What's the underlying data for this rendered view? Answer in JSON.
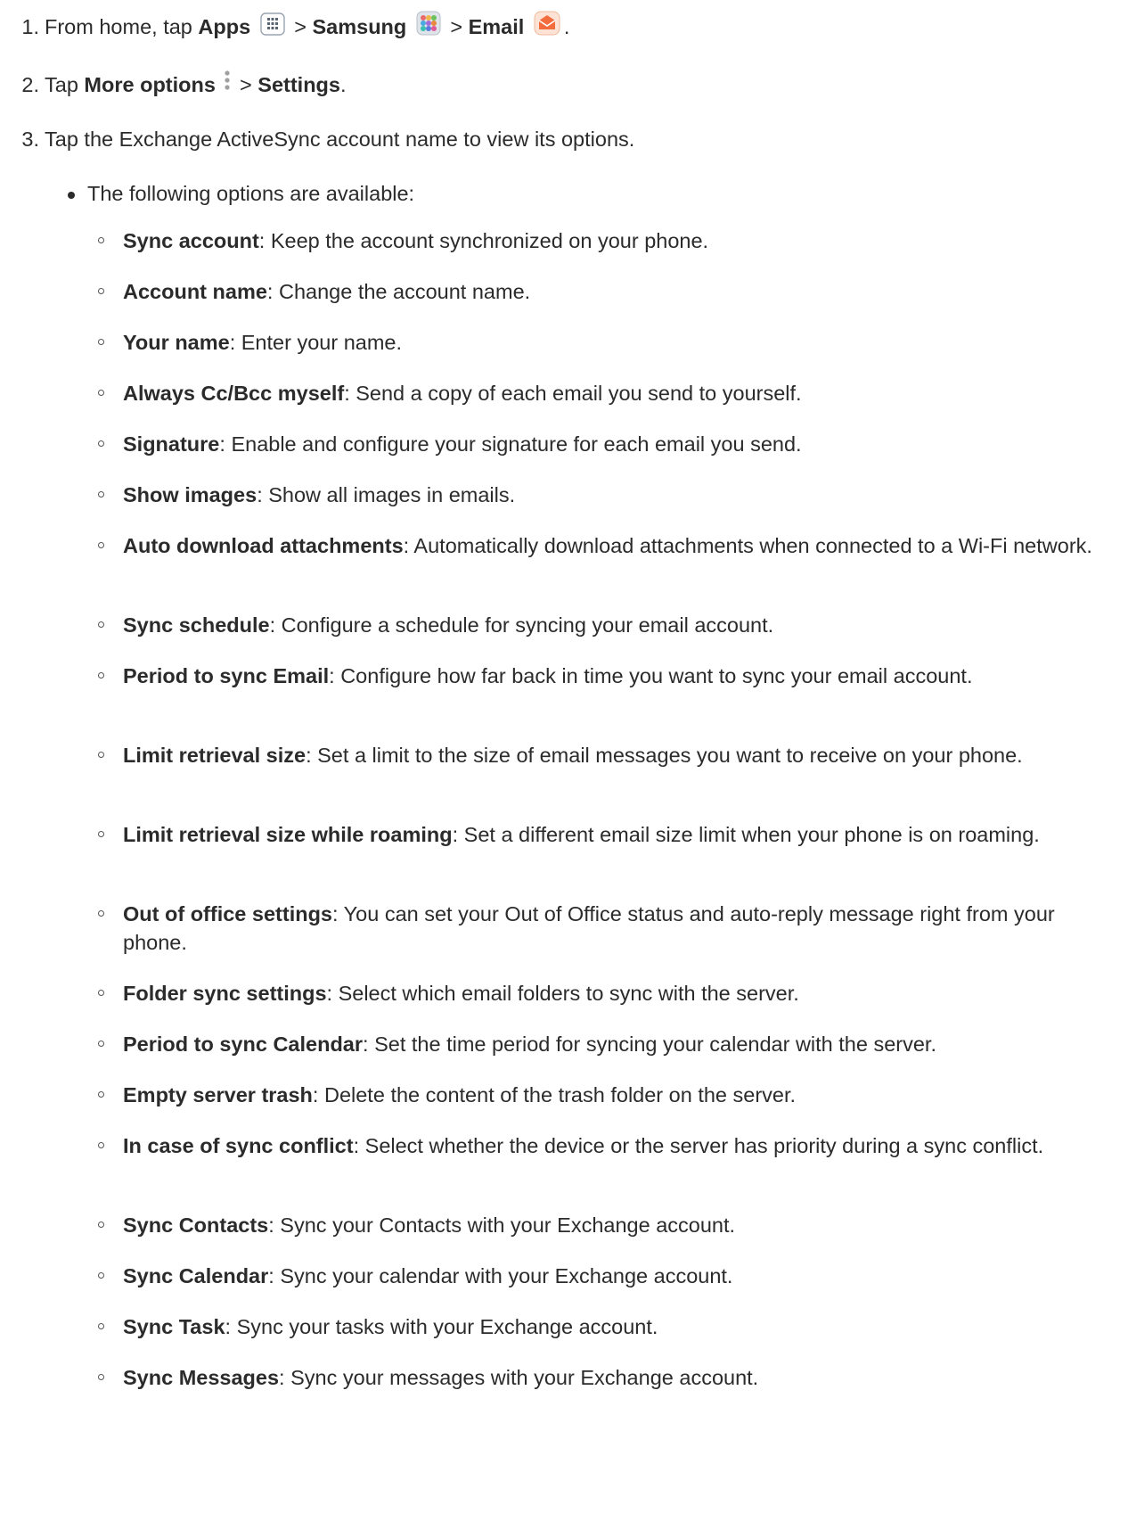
{
  "steps": [
    {
      "num": "1.",
      "prefix": "From home, tap ",
      "apps": "Apps",
      "sep1": " > ",
      "samsung": "Samsung",
      "sep2": " > ",
      "email": "Email",
      "end": "."
    },
    {
      "num": "2.",
      "prefix": "Tap ",
      "more": "More options",
      "sep": " > ",
      "settings": "Settings",
      "end": "."
    },
    {
      "num": "3.",
      "text": "Tap the Exchange ActiveSync account name to view its options."
    }
  ],
  "bullet": "The following options are available:",
  "options": [
    {
      "name": "Sync account",
      "desc": ": Keep the account synchronized on your phone."
    },
    {
      "name": "Account name",
      "desc": ": Change the account name."
    },
    {
      "name": "Your name",
      "desc": ": Enter your name."
    },
    {
      "name": "Always Cc/Bcc myself",
      "desc": ": Send a copy of each email you send to yourself."
    },
    {
      "name": "Signature",
      "desc": ": Enable and configure your signature for each email you send."
    },
    {
      "name": "Show images",
      "desc": ": Show all images in emails."
    },
    {
      "name": "Auto download attachments",
      "desc": ": Automatically download attachments when connected to a Wi-Fi network."
    },
    {
      "name": "Sync schedule",
      "desc": ": Configure a schedule for syncing your email account."
    },
    {
      "name": "Period to sync Email",
      "desc": ": Configure how far back in time you want to sync your email account."
    },
    {
      "name": "Limit retrieval size",
      "desc": ": Set a limit to the size of email messages you want to receive on your phone."
    },
    {
      "name": "Limit retrieval size while roaming",
      "desc": ": Set a different email size limit when your phone is on roaming."
    },
    {
      "name": "Out of office settings",
      "desc": ": You can set your Out of Office status and auto-reply message right from your phone."
    },
    {
      "name": "Folder sync settings",
      "desc": ": Select which email folders to sync with the server."
    },
    {
      "name": "Period to sync Calendar",
      "desc": ": Set the time period for syncing your calendar with the server."
    },
    {
      "name": "Empty server trash",
      "desc": ": Delete the content of the trash folder on the server."
    },
    {
      "name": "In case of sync conflict",
      "desc": ": Select whether the device or the server has priority during a sync conflict."
    },
    {
      "name": "Sync Contacts",
      "desc": ": Sync your Contacts with your Exchange account."
    },
    {
      "name": "Sync Calendar",
      "desc": ": Sync your calendar with your Exchange account."
    },
    {
      "name": "Sync Task",
      "desc": ": Sync your tasks with your Exchange account."
    },
    {
      "name": "Sync Messages",
      "desc": ": Sync your messages with your Exchange account."
    }
  ],
  "icons": {
    "apps": "apps-grid-icon",
    "samsung": "samsung-folder-icon",
    "email": "email-app-icon",
    "more": "more-options-icon"
  }
}
